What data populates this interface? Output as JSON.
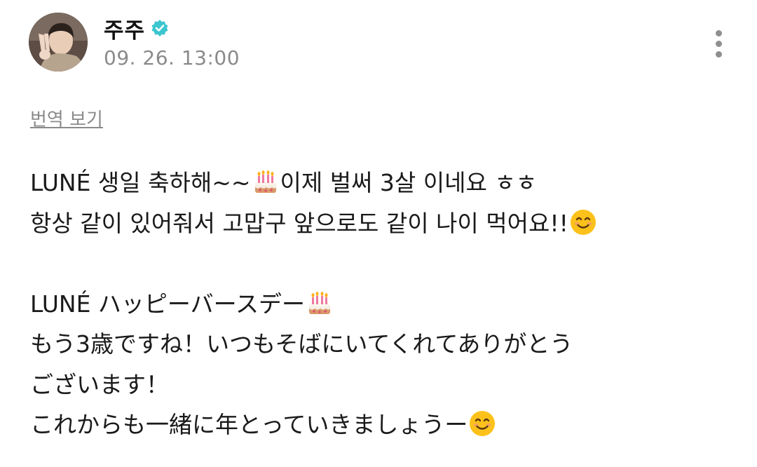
{
  "post": {
    "author": {
      "name": "주주",
      "verified": true,
      "avatar_icon": "user-avatar-photo"
    },
    "timestamp": "09. 26. 13:00",
    "translate_label": "번역 보기",
    "more_icon": "more-vertical-icon",
    "lines": [
      [
        "LUNÉ 생일 축하해~~",
        "birthday-cake-emoji",
        "이제 벌써 3살 이네요 ㅎㅎ"
      ],
      [
        "항상 같이 있어줘서 고맙구 앞으로도 같이 나이 먹어요!!",
        "smiling-face-emoji"
      ],
      [],
      [
        "LUNÉ ハッピーバースデー",
        "birthday-cake-emoji"
      ],
      [
        "もう3歳ですね！いつもそばにいてくれてありがとう"
      ],
      [
        "ございます！"
      ],
      [
        "これからも一緒に年とっていきましょうー",
        "smiling-face-emoji"
      ]
    ]
  },
  "colors": {
    "text": "#1a1a1a",
    "meta": "#8a8a8a",
    "verified_badge": "#3cc6cf",
    "background": "#ffffff"
  }
}
